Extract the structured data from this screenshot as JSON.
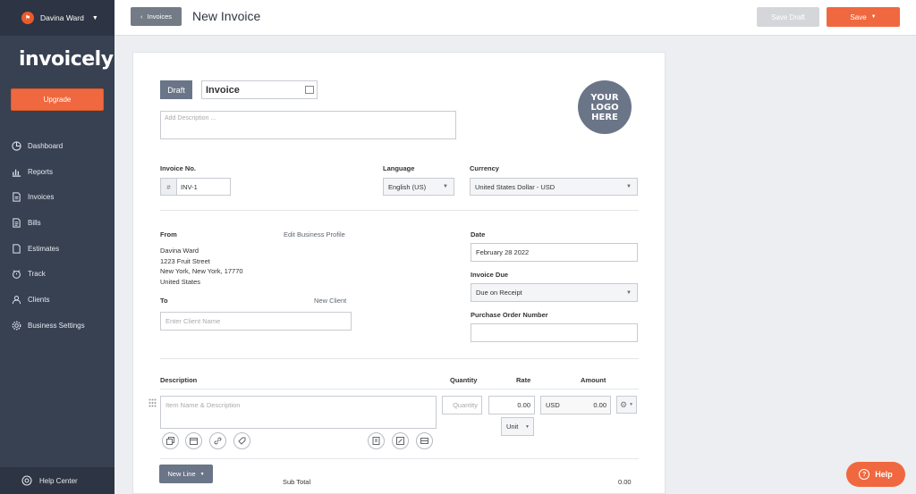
{
  "user": {
    "name": "Davina Ward",
    "avatar_icon": "flag-icon"
  },
  "brand": {
    "logo_text": "invoicely",
    "accent": "#f0683f",
    "sidebar_bg": "#384152"
  },
  "sidebar": {
    "upgrade_label": "Upgrade",
    "items": [
      {
        "label": "Dashboard",
        "icon": "dashboard-icon"
      },
      {
        "label": "Reports",
        "icon": "reports-icon"
      },
      {
        "label": "Invoices",
        "icon": "invoice-icon"
      },
      {
        "label": "Bills",
        "icon": "bill-icon"
      },
      {
        "label": "Estimates",
        "icon": "estimate-icon"
      },
      {
        "label": "Track",
        "icon": "track-icon"
      },
      {
        "label": "Clients",
        "icon": "clients-icon"
      },
      {
        "label": "Business Settings",
        "icon": "gear-icon"
      }
    ],
    "help_center": "Help Center"
  },
  "topbar": {
    "back_label": "Invoices",
    "title": "New Invoice",
    "save_draft_label": "Save Draft",
    "save_label": "Save"
  },
  "invoice": {
    "status": "Draft",
    "title": "Invoice",
    "description_placeholder": "Add Description ...",
    "logo_text": "YOUR LOGO HERE",
    "invoice_no_label": "Invoice No.",
    "invoice_no_prefix": "#",
    "invoice_no": "INV-1",
    "language_label": "Language",
    "language": "English (US)",
    "currency_label": "Currency",
    "currency": "United States Dollar - USD",
    "from_label": "From",
    "edit_profile_link": "Edit Business Profile",
    "from_name": "Davina Ward",
    "from_street": "1223 Fruit Street",
    "from_city": "New York, New York, 17770",
    "from_country": "United States",
    "to_label": "To",
    "new_client_link": "New Client",
    "client_placeholder": "Enter Client Name",
    "date_label": "Date",
    "date": "February 28 2022",
    "due_label": "Invoice Due",
    "due": "Due on Receipt",
    "po_label": "Purchase Order Number",
    "po_number": ""
  },
  "items": {
    "headers": {
      "description": "Description",
      "quantity": "Quantity",
      "rate": "Rate",
      "amount": "Amount"
    },
    "item_placeholder": "Item Name & Description",
    "quantity_placeholder": "Quantity",
    "rate": "0.00",
    "amount_currency": "USD",
    "amount": "0.00",
    "unit_label": "Unit",
    "new_line_label": "New Line",
    "subtotal_label": "Sub Total",
    "subtotal": "0.00"
  },
  "help_button": "Help"
}
